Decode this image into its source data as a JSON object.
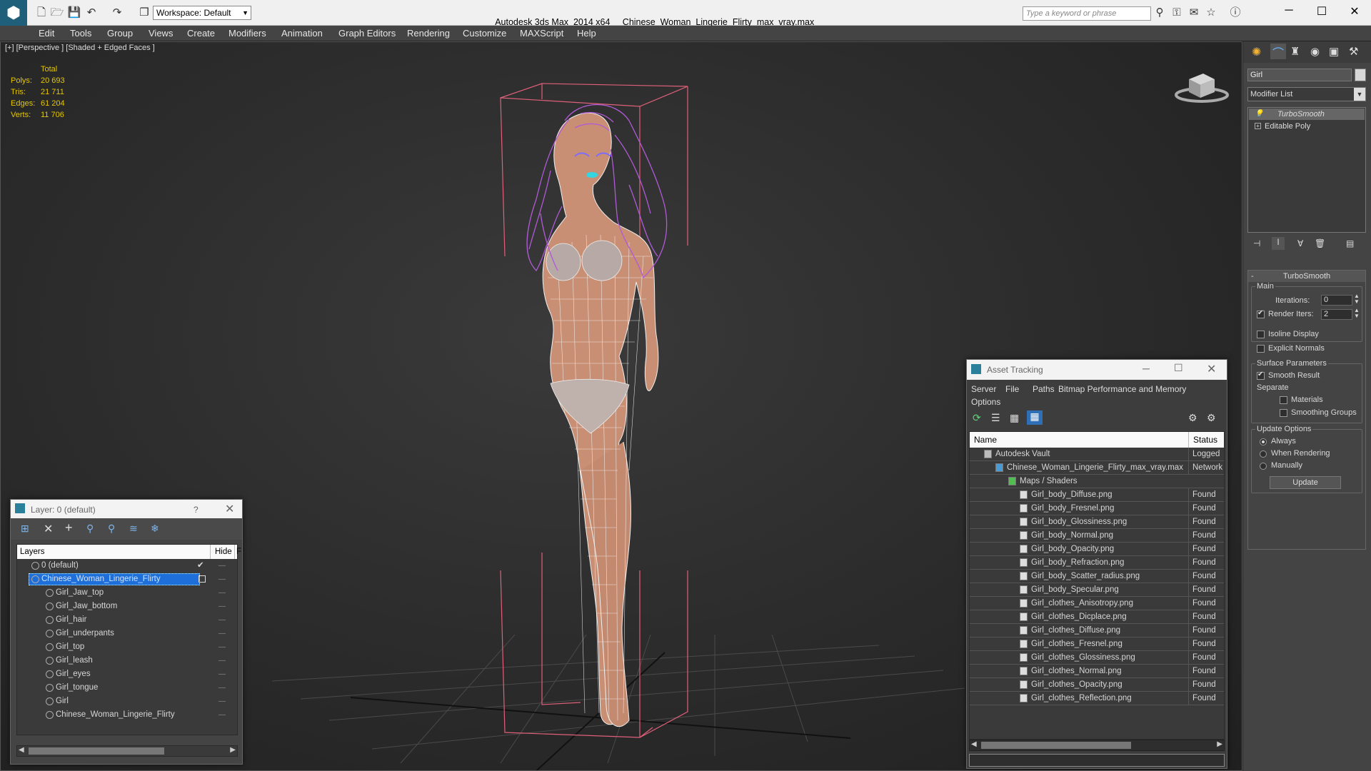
{
  "titlebar": {
    "app_title": "Autodesk 3ds Max  2014 x64",
    "file_name": "Chinese_Woman_Lingerie_Flirty_max_vray.max",
    "workspace": "Workspace: Default",
    "search_placeholder": "Type a keyword or phrase"
  },
  "menu": [
    "Edit",
    "Tools",
    "Group",
    "Views",
    "Create",
    "Modifiers",
    "Animation",
    "Graph Editors",
    "Rendering",
    "Customize",
    "MAXScript",
    "Help"
  ],
  "viewport": {
    "label": "[+] [Perspective ] [Shaded + Edged Faces ]",
    "stats": {
      "header": "Total",
      "rows": [
        {
          "k": "Polys:",
          "v": "20 693"
        },
        {
          "k": "Tris:",
          "v": "21 711"
        },
        {
          "k": "Edges:",
          "v": "61 204"
        },
        {
          "k": "Verts:",
          "v": "11 706"
        }
      ]
    }
  },
  "layer_panel": {
    "title": "Layer: 0 (default)",
    "help": "?",
    "col_layers": "Layers",
    "col_hide": "Hide",
    "col_f": "F",
    "rows": [
      {
        "name": "0 (default)",
        "indent": 0
      },
      {
        "name": "Chinese_Woman_Lingerie_Flirty",
        "indent": 0,
        "selected": true
      },
      {
        "name": "Girl_Jaw_top",
        "indent": 1
      },
      {
        "name": "Girl_Jaw_bottom",
        "indent": 1
      },
      {
        "name": "Girl_hair",
        "indent": 1
      },
      {
        "name": "Girl_underpants",
        "indent": 1
      },
      {
        "name": "Girl_top",
        "indent": 1
      },
      {
        "name": "Girl_leash",
        "indent": 1
      },
      {
        "name": "Girl_eyes",
        "indent": 1
      },
      {
        "name": "Girl_tongue",
        "indent": 1
      },
      {
        "name": "Girl",
        "indent": 1
      },
      {
        "name": "Chinese_Woman_Lingerie_Flirty",
        "indent": 1
      }
    ]
  },
  "asset_tracking": {
    "title": "Asset Tracking",
    "menu": [
      "Server",
      "File",
      "Paths",
      "Bitmap Performance and Memory",
      "Options"
    ],
    "col_name": "Name",
    "col_status": "Status",
    "rows": [
      {
        "name": "Autodesk Vault",
        "status": "Logged",
        "level": 0
      },
      {
        "name": "Chinese_Woman_Lingerie_Flirty_max_vray.max",
        "status": "Network",
        "level": 1
      },
      {
        "name": "Maps / Shaders",
        "status": "",
        "level": 2
      },
      {
        "name": "Girl_body_Diffuse.png",
        "status": "Found",
        "level": 3
      },
      {
        "name": "Girl_body_Fresnel.png",
        "status": "Found",
        "level": 3
      },
      {
        "name": "Girl_body_Glossiness.png",
        "status": "Found",
        "level": 3
      },
      {
        "name": "Girl_body_Normal.png",
        "status": "Found",
        "level": 3
      },
      {
        "name": "Girl_body_Opacity.png",
        "status": "Found",
        "level": 3
      },
      {
        "name": "Girl_body_Refraction.png",
        "status": "Found",
        "level": 3
      },
      {
        "name": "Girl_body_Scatter_radius.png",
        "status": "Found",
        "level": 3
      },
      {
        "name": "Girl_body_Specular.png",
        "status": "Found",
        "level": 3
      },
      {
        "name": "Girl_clothes_Anisotropy.png",
        "status": "Found",
        "level": 3
      },
      {
        "name": "Girl_clothes_Dicplace.png",
        "status": "Found",
        "level": 3
      },
      {
        "name": "Girl_clothes_Diffuse.png",
        "status": "Found",
        "level": 3
      },
      {
        "name": "Girl_clothes_Fresnel.png",
        "status": "Found",
        "level": 3
      },
      {
        "name": "Girl_clothes_Glossiness.png",
        "status": "Found",
        "level": 3
      },
      {
        "name": "Girl_clothes_Normal.png",
        "status": "Found",
        "level": 3
      },
      {
        "name": "Girl_clothes_Opacity.png",
        "status": "Found",
        "level": 3
      },
      {
        "name": "Girl_clothes_Reflection.png",
        "status": "Found",
        "level": 3
      }
    ]
  },
  "command_panel": {
    "object_name": "Girl",
    "modifier_list": "Modifier List",
    "stack": [
      "TurboSmooth",
      "Editable Poly"
    ],
    "rollout_title": "TurboSmooth",
    "main_group": "Main",
    "iterations_label": "Iterations:",
    "iterations_value": "0",
    "render_iters_label": "Render Iters:",
    "render_iters_value": "2",
    "isoline": "Isoline Display",
    "explicit_normals": "Explicit Normals",
    "surface_group": "Surface Parameters",
    "smooth_result": "Smooth Result",
    "separate": "Separate",
    "materials": "Materials",
    "smoothing_groups": "Smoothing Groups",
    "update_group": "Update Options",
    "always": "Always",
    "when_rendering": "When Rendering",
    "manually": "Manually",
    "update_button": "Update"
  },
  "colors": {
    "accent_selected": "#1e6fd9",
    "wireframe": "#e8e8e8",
    "skin": "#c98f74",
    "hair": "#b05ad6",
    "bbox": "#e0607a",
    "stats_text": "#e6c700"
  }
}
